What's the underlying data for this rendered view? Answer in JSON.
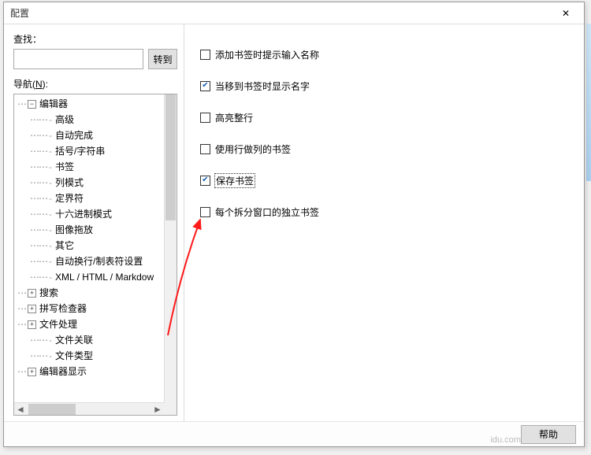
{
  "window": {
    "title": "配置",
    "close_glyph": "✕"
  },
  "search": {
    "label": "查找：",
    "value": "",
    "go_label": "转到"
  },
  "nav": {
    "label_prefix": "导航(",
    "label_key": "N",
    "label_suffix": "):",
    "tree": [
      {
        "level": 0,
        "exp": "minus",
        "label": "编辑器"
      },
      {
        "level": 1,
        "exp": "leaf",
        "label": "高级"
      },
      {
        "level": 1,
        "exp": "leaf",
        "label": "自动完成"
      },
      {
        "level": 1,
        "exp": "leaf",
        "label": "括号/字符串"
      },
      {
        "level": 1,
        "exp": "leaf",
        "label": "书签"
      },
      {
        "level": 1,
        "exp": "leaf",
        "label": "列模式"
      },
      {
        "level": 1,
        "exp": "leaf",
        "label": "定界符"
      },
      {
        "level": 1,
        "exp": "leaf",
        "label": "十六进制模式"
      },
      {
        "level": 1,
        "exp": "leaf",
        "label": "图像拖放"
      },
      {
        "level": 1,
        "exp": "leaf",
        "label": "其它"
      },
      {
        "level": 1,
        "exp": "leaf",
        "label": "自动换行/制表符设置"
      },
      {
        "level": 1,
        "exp": "leaf",
        "label": "XML / HTML / Markdow"
      },
      {
        "level": 0,
        "exp": "plus",
        "label": "搜索"
      },
      {
        "level": 0,
        "exp": "plus",
        "label": "拼写检查器"
      },
      {
        "level": 0,
        "exp": "plus",
        "label": "文件处理"
      },
      {
        "level": 1,
        "exp": "leaf",
        "label": "文件关联"
      },
      {
        "level": 1,
        "exp": "leaf",
        "label": "文件类型"
      },
      {
        "level": 0,
        "exp": "plus",
        "label": "编辑器显示"
      }
    ]
  },
  "options": [
    {
      "key": "o0",
      "checked": false,
      "label": "添加书签时提示输入名称",
      "boxed": false
    },
    {
      "key": "o1",
      "checked": true,
      "label": "当移到书签时显示名字",
      "boxed": false
    },
    {
      "key": "o2",
      "checked": false,
      "label": "高亮整行",
      "boxed": false
    },
    {
      "key": "o3",
      "checked": false,
      "label": "使用行做列的书签",
      "boxed": false
    },
    {
      "key": "o4",
      "checked": true,
      "label": "保存书签",
      "boxed": true
    },
    {
      "key": "o5",
      "checked": false,
      "label": "每个拆分窗口的独立书签",
      "boxed": false
    }
  ],
  "footer": {
    "help_label": "帮助",
    "watermark": "idu.com"
  },
  "annotation": {
    "arrow_color": "#ff1a1a"
  }
}
